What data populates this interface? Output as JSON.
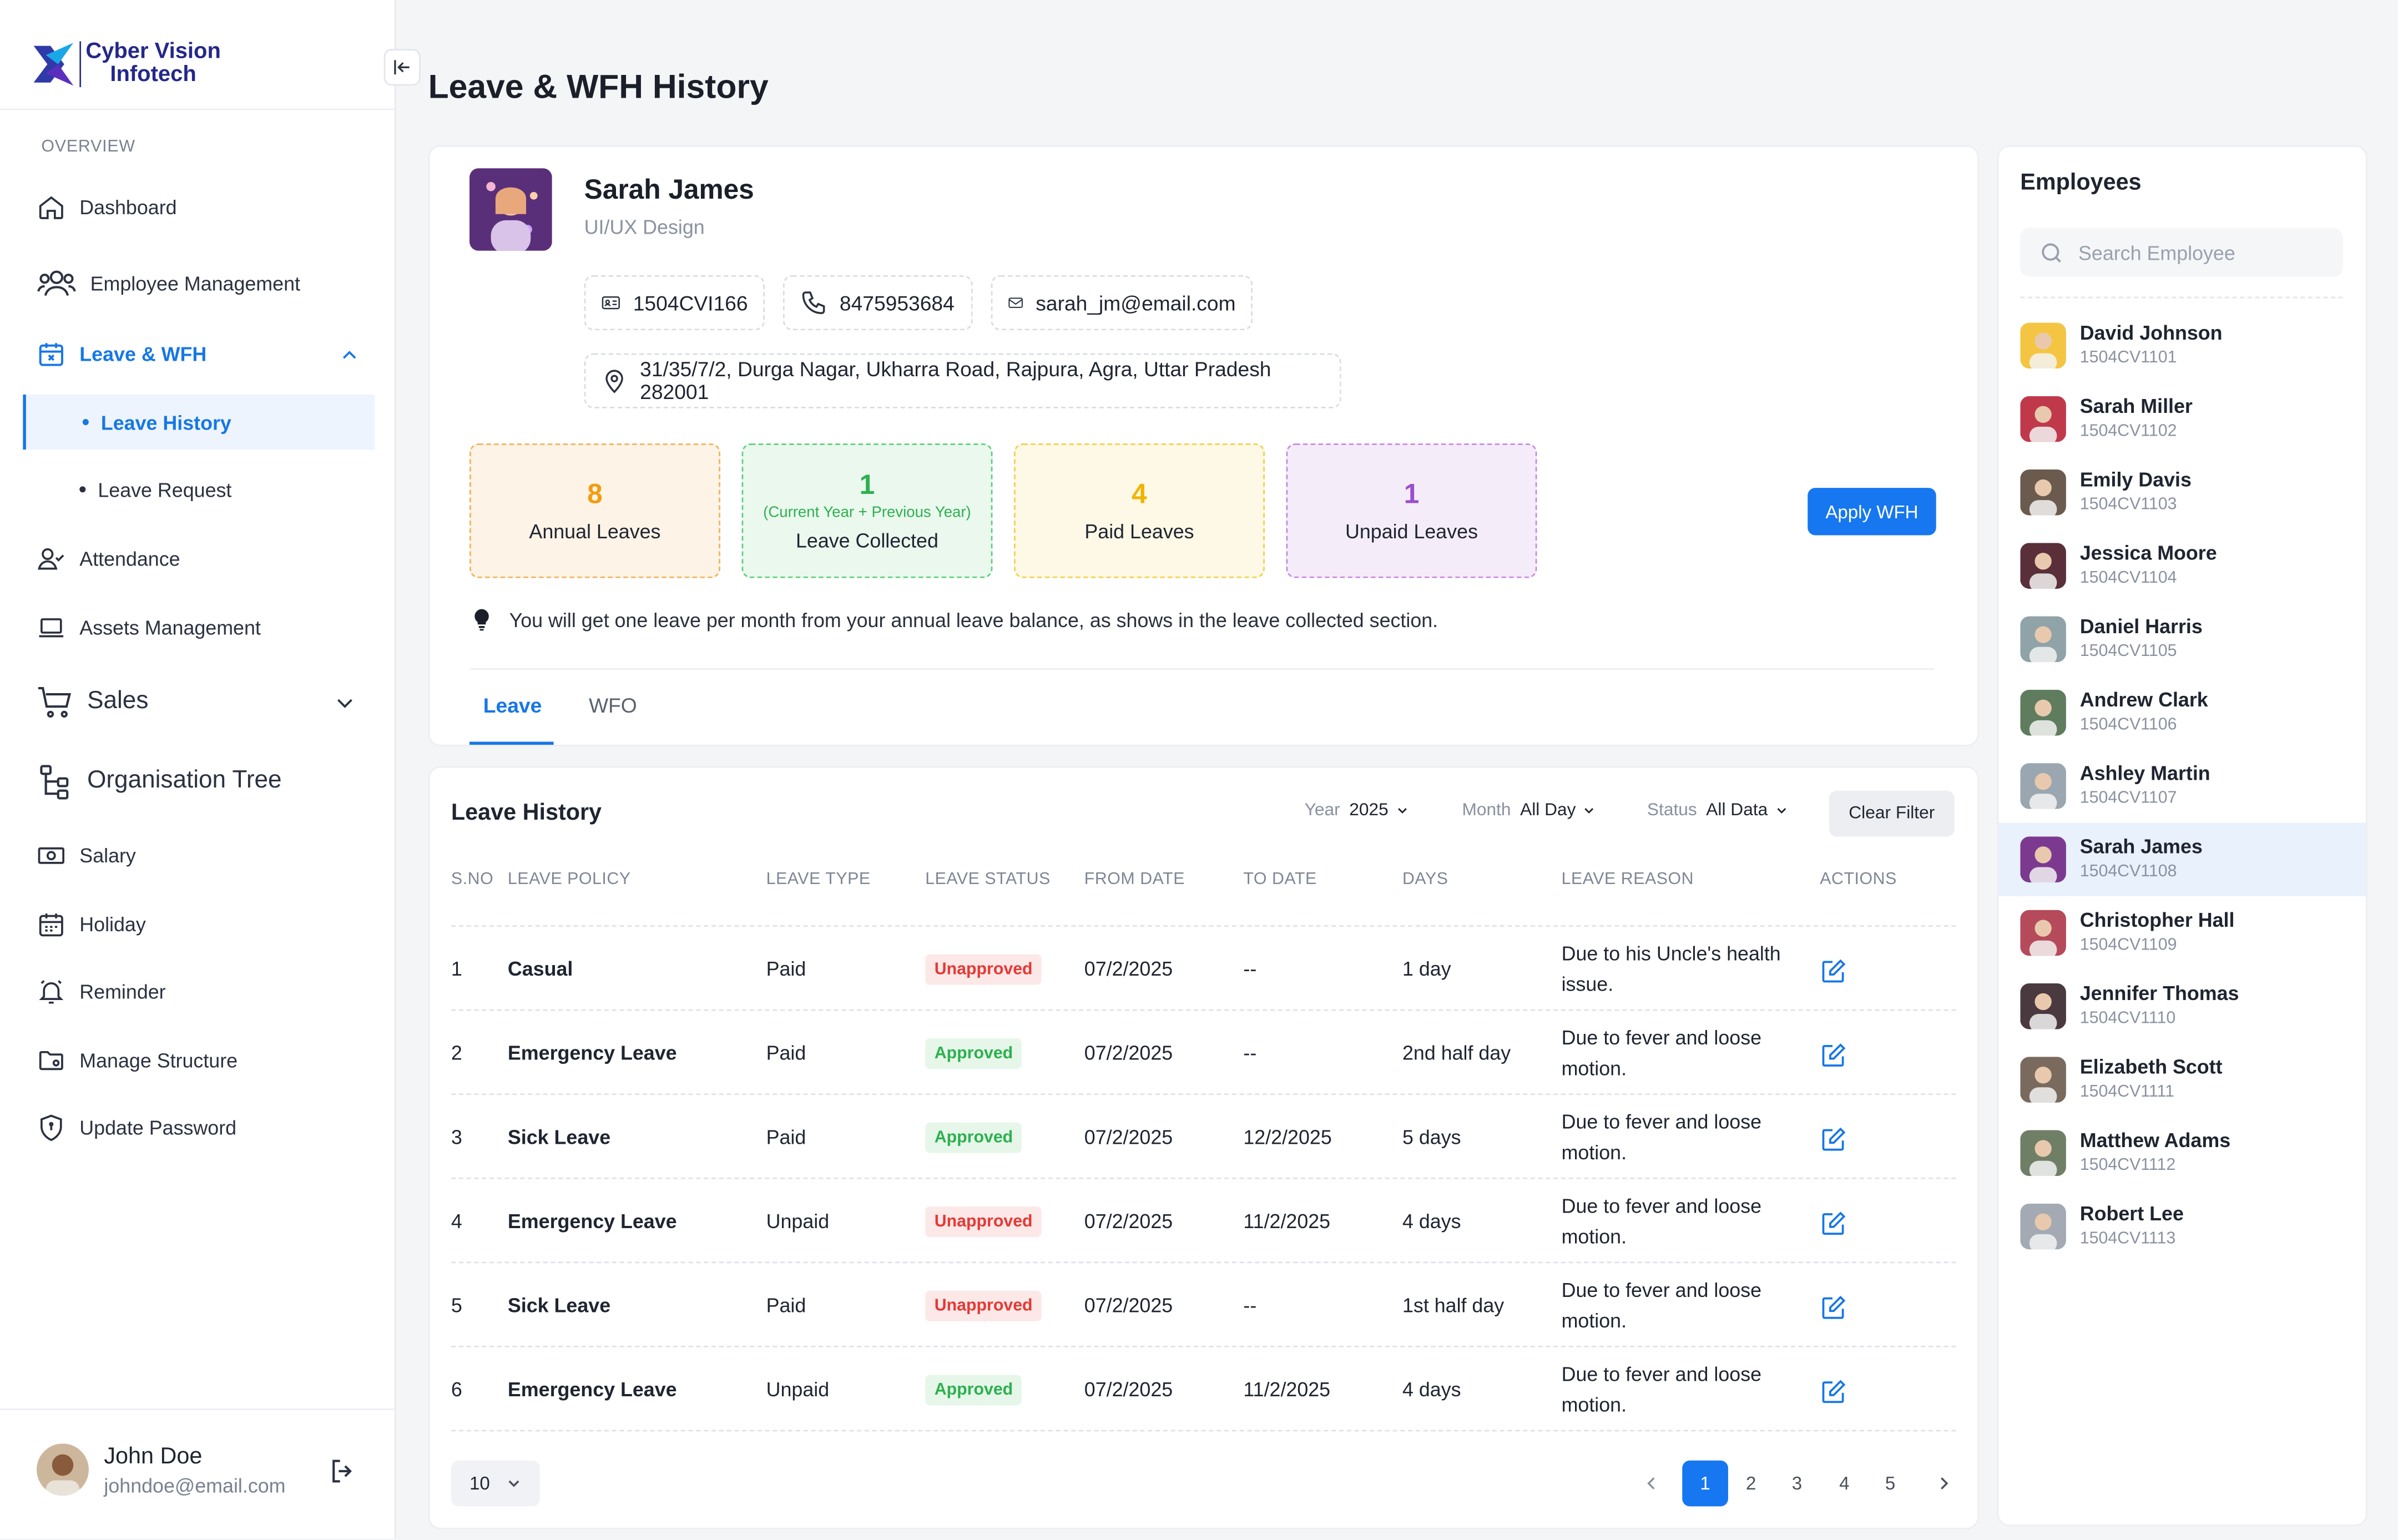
{
  "brand": {
    "line1": "Cyber Vision",
    "line2": "Infotech"
  },
  "sidebar": {
    "section_label": "OVERVIEW",
    "items": [
      {
        "label": "Dashboard",
        "icon": "home-icon"
      },
      {
        "label": "Employee Management",
        "icon": "users-icon"
      },
      {
        "label": "Leave & WFH",
        "icon": "calendar-x-icon",
        "active": true,
        "expanded": true
      },
      {
        "label": "Attendance",
        "icon": "user-check-icon"
      },
      {
        "label": "Assets Management",
        "icon": "laptop-icon"
      },
      {
        "label": "Sales",
        "icon": "cart-icon"
      },
      {
        "label": "Organisation Tree",
        "icon": "tree-icon"
      },
      {
        "label": "Salary",
        "icon": "money-icon"
      },
      {
        "label": "Holiday",
        "icon": "calendar-icon"
      },
      {
        "label": "Reminder",
        "icon": "bell-icon"
      },
      {
        "label": "Manage Structure",
        "icon": "folder-settings-icon"
      },
      {
        "label": "Update Password",
        "icon": "shield-icon"
      }
    ],
    "subitems": [
      {
        "label": "Leave History",
        "active": true
      },
      {
        "label": "Leave Request"
      }
    ],
    "user": {
      "name": "John Doe",
      "email": "johndoe@email.com"
    }
  },
  "page": {
    "title": "Leave & WFH History"
  },
  "profile": {
    "name": "Sarah James",
    "role": "UI/UX Design",
    "emp_id": "1504CVI166",
    "phone": "8475953684",
    "email": "sarah_jm@email.com",
    "address": "31/35/7/2, Durga Nagar, Ukharra Road, Rajpura, Agra, Uttar Pradesh 282001"
  },
  "stats": [
    {
      "value": "8",
      "label": "Annual Leaves",
      "color": "#f39c12"
    },
    {
      "value": "1",
      "sub": "(Current Year + Previous Year)",
      "label": "Leave Collected",
      "color": "#2eb04f"
    },
    {
      "value": "4",
      "label": "Paid Leaves",
      "color": "#f0b400"
    },
    {
      "value": "1",
      "label": "Unpaid Leaves",
      "color": "#9b4dca"
    }
  ],
  "apply_wfh": "Apply WFH",
  "tip": "You will get one leave per month from your annual leave balance, as shows in the leave collected section.",
  "tabs": [
    "Leave",
    "WFO"
  ],
  "table": {
    "title": "Leave History",
    "filters": {
      "year_label": "Year",
      "year_value": "2025",
      "month_label": "Month",
      "month_value": "All Day",
      "status_label": "Status",
      "status_value": "All Data",
      "clear": "Clear Filter"
    },
    "headers": [
      "S.NO",
      "LEAVE POLICY",
      "LEAVE TYPE",
      "LEAVE STATUS",
      "FROM DATE",
      "TO DATE",
      "DAYS",
      "LEAVE REASON",
      "ACTIONS"
    ],
    "rows": [
      {
        "sno": "1",
        "policy": "Casual",
        "type": "Paid",
        "status": "Unapproved",
        "from": "07/2/2025",
        "to": "--",
        "days": "1 day",
        "reason": "Due to his Uncle's health issue."
      },
      {
        "sno": "2",
        "policy": "Emergency Leave",
        "type": "Paid",
        "status": "Approved",
        "from": "07/2/2025",
        "to": "--",
        "days": "2nd half day",
        "reason": "Due to fever and loose motion."
      },
      {
        "sno": "3",
        "policy": "Sick Leave",
        "type": "Paid",
        "status": "Approved",
        "from": "07/2/2025",
        "to": "12/2/2025",
        "days": "5 days",
        "reason": "Due to fever and loose motion."
      },
      {
        "sno": "4",
        "policy": "Emergency Leave",
        "type": "Unpaid",
        "status": "Unapproved",
        "from": "07/2/2025",
        "to": "11/2/2025",
        "days": "4 days",
        "reason": "Due to fever and loose motion."
      },
      {
        "sno": "5",
        "policy": "Sick Leave",
        "type": "Paid",
        "status": "Unapproved",
        "from": "07/2/2025",
        "to": "--",
        "days": "1st half day",
        "reason": "Due to fever and loose motion."
      },
      {
        "sno": "6",
        "policy": "Emergency Leave",
        "type": "Unpaid",
        "status": "Approved",
        "from": "07/2/2025",
        "to": "11/2/2025",
        "days": "4 days",
        "reason": "Due to fever and loose motion."
      }
    ],
    "rows_per_page": "10",
    "pages": [
      "1",
      "2",
      "3",
      "4",
      "5"
    ],
    "current_page": "1"
  },
  "employees": {
    "title": "Employees",
    "search_placeholder": "Search Employee",
    "list": [
      {
        "name": "David Johnson",
        "id": "1504CV1101",
        "color": "#f4c542"
      },
      {
        "name": "Sarah Miller",
        "id": "1504CV1102",
        "color": "#c0394b"
      },
      {
        "name": "Emily Davis",
        "id": "1504CV1103",
        "color": "#6b5a4e"
      },
      {
        "name": "Jessica Moore",
        "id": "1504CV1104",
        "color": "#5a2f3a"
      },
      {
        "name": "Daniel Harris",
        "id": "1504CV1105",
        "color": "#8fa3a8"
      },
      {
        "name": "Andrew Clark",
        "id": "1504CV1106",
        "color": "#5f7d5e"
      },
      {
        "name": "Ashley Martin",
        "id": "1504CV1107",
        "color": "#9aa7b0"
      },
      {
        "name": "Sarah James",
        "id": "1504CV1108",
        "color": "#7b3a8f",
        "active": true
      },
      {
        "name": "Christopher Hall",
        "id": "1504CV1109",
        "color": "#b54a5a"
      },
      {
        "name": "Jennifer Thomas",
        "id": "1504CV1110",
        "color": "#4a3a3f"
      },
      {
        "name": "Elizabeth Scott",
        "id": "1504CV1111",
        "color": "#7a6a5e"
      },
      {
        "name": "Matthew Adams",
        "id": "1504CV1112",
        "color": "#6f7f66"
      },
      {
        "name": "Robert Lee",
        "id": "1504CV1113",
        "color": "#a3aab3"
      }
    ]
  }
}
